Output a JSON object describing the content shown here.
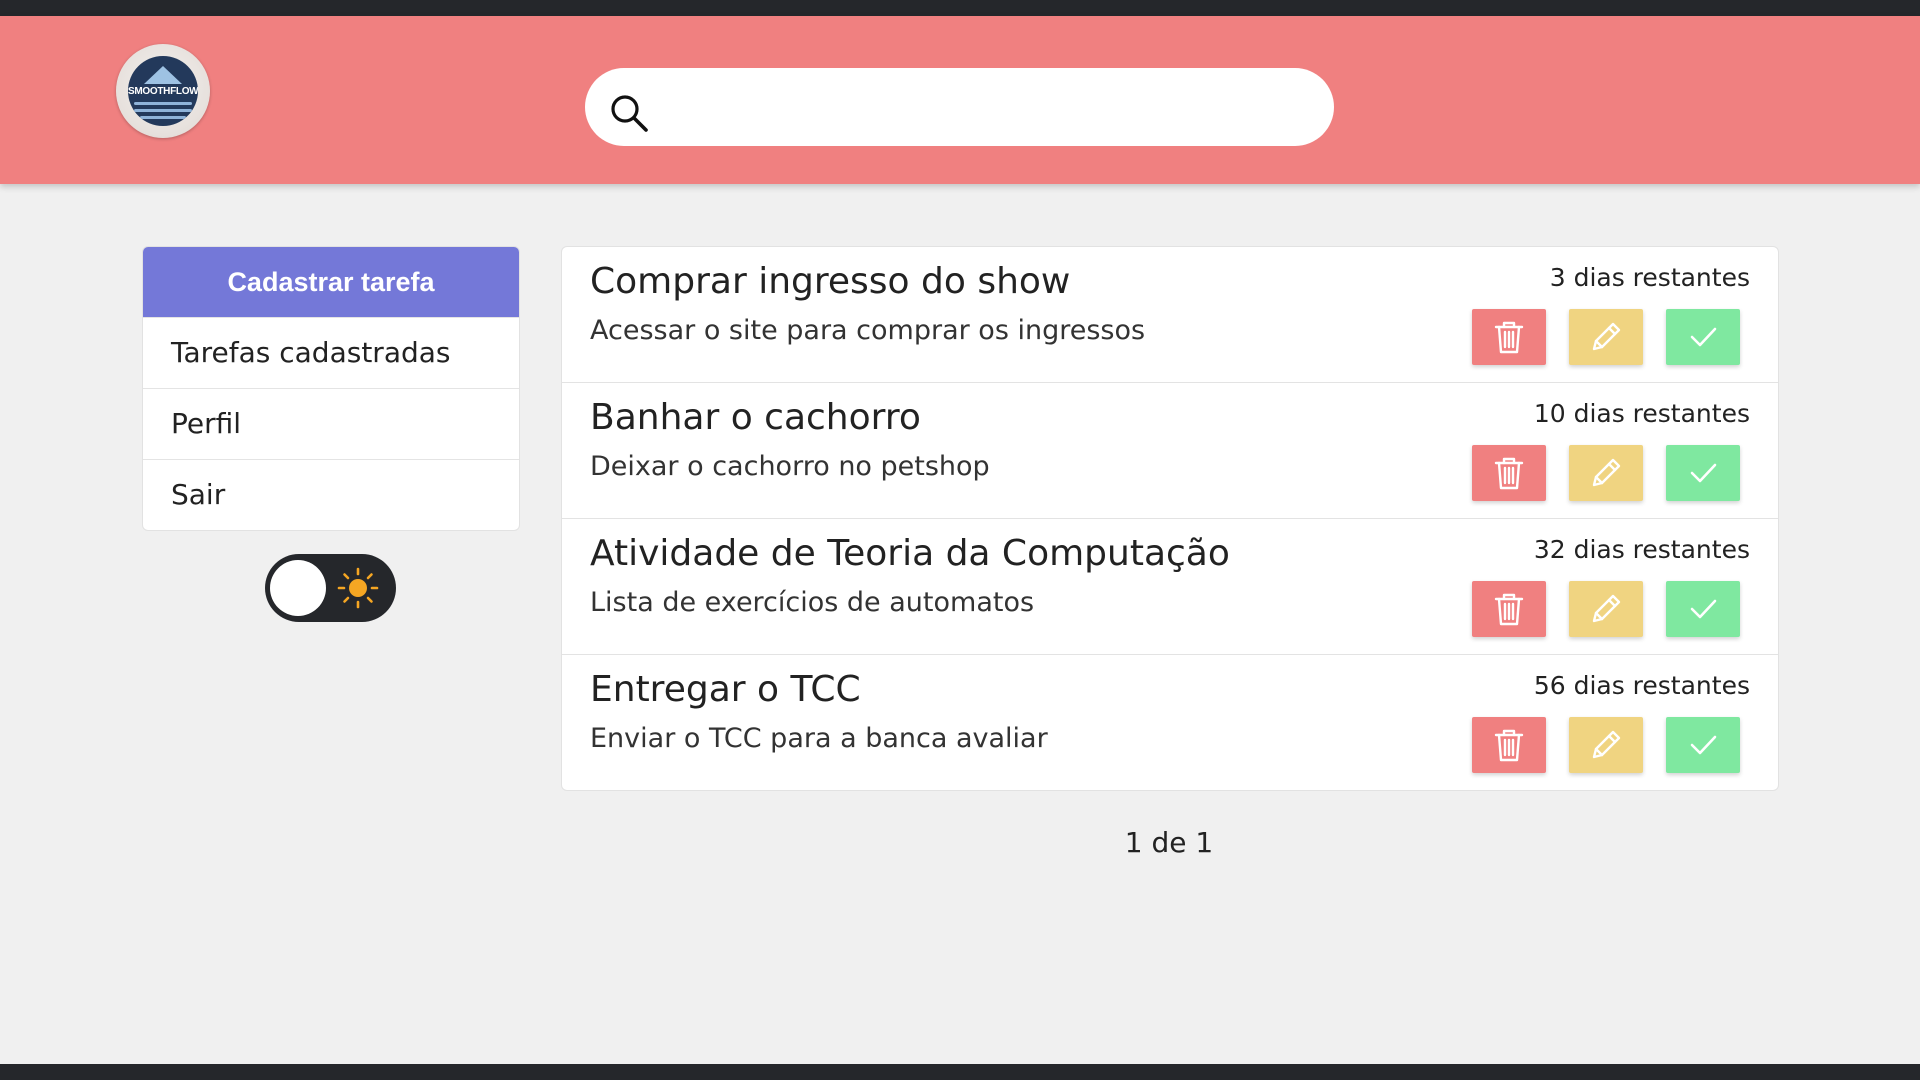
{
  "header": {
    "logo_text": "SMOOTHFLOW",
    "search": {
      "placeholder": "",
      "value": ""
    }
  },
  "sidebar": {
    "items": [
      {
        "label": "Cadastrar tarefa"
      },
      {
        "label": "Tarefas cadastradas"
      },
      {
        "label": "Perfil"
      },
      {
        "label": "Sair"
      }
    ]
  },
  "theme_toggle": {
    "mode": "light",
    "icon": "sun-icon"
  },
  "tasks": [
    {
      "title": "Comprar ingresso do show",
      "description": "Acessar o site para comprar os ingressos",
      "days_left": "3 dias restantes"
    },
    {
      "title": "Banhar o cachorro",
      "description": "Deixar o cachorro no petshop",
      "days_left": "10 dias restantes"
    },
    {
      "title": "Atividade de Teoria da Computação",
      "description": "Lista de exercícios de automatos",
      "days_left": "32 dias restantes"
    },
    {
      "title": "Entregar o TCC",
      "description": "Enviar o TCC para a banca avaliar",
      "days_left": "56 dias restantes"
    }
  ],
  "task_actions": {
    "delete_icon": "trash-icon",
    "edit_icon": "pencil-icon",
    "done_icon": "check-icon"
  },
  "pagination": {
    "text": "1 de 1"
  },
  "colors": {
    "header": "#f08080",
    "primary": "#7478d8",
    "delete": "#f08080",
    "edit": "#f0d481",
    "done": "#7fe8a0",
    "dark": "#25272b",
    "sun": "#f5a623"
  }
}
